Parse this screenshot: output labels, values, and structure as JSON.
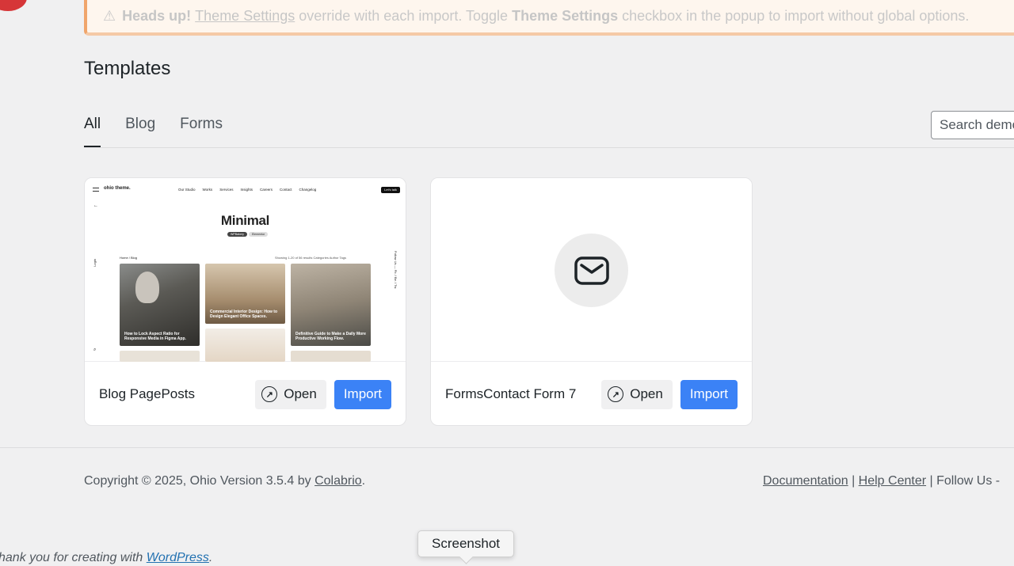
{
  "notice": {
    "heading": "Heads up!",
    "link": "Theme Settings",
    "text1": "override with each import. Toggle",
    "bold2": "Theme Settings",
    "text2": "checkbox in the popup to import without global options."
  },
  "page": {
    "title": "Templates"
  },
  "tabs": [
    {
      "label": "All",
      "active": true
    },
    {
      "label": "Blog",
      "active": false
    },
    {
      "label": "Forms",
      "active": false
    }
  ],
  "search": {
    "placeholder": "Search demos"
  },
  "cards": [
    {
      "name": "Blog PagePosts",
      "open_label": "Open",
      "import_label": "Import",
      "preview": {
        "logo": "ohio theme.",
        "nav": [
          "Our Studio",
          "Works",
          "Services",
          "Insights",
          "Careers",
          "Contact",
          "Changelog"
        ],
        "cta": "Let's talk",
        "hero": "Minimal",
        "pills": [
          "WPBakery",
          "Elementor"
        ],
        "crumb": "Home / Blog",
        "meta": "Showing 1-20 of 56 results   Categories   Author   Tags",
        "side_left": "Login",
        "side_right": "Follow Us — Fb. / Be. / Tw.",
        "posts": [
          "How to Lock Aspect Ratio for Responsive Media in Figma App.",
          "Commercial Interior Design: How to Design Elegant Office Spaces.",
          "Definitive Guide to Make a Daily More Productive Working Flow."
        ]
      }
    },
    {
      "name": "FormsContact Form 7",
      "open_label": "Open",
      "import_label": "Import"
    }
  ],
  "footer": {
    "copyright": "Copyright © 2025, Ohio Version 3.5.4 by ",
    "brand": "Colabrio",
    "period": ".",
    "links": [
      "Documentation",
      "Help Center"
    ],
    "follow": "Follow Us -"
  },
  "wp_footer": {
    "text": "hank you for creating with ",
    "link": "WordPress",
    "period": "."
  },
  "tooltip": {
    "label": "Screenshot"
  },
  "colors": {
    "accent": "#3b82f6",
    "notice_border": "#f0a56b",
    "wp_red": "#d63638"
  }
}
